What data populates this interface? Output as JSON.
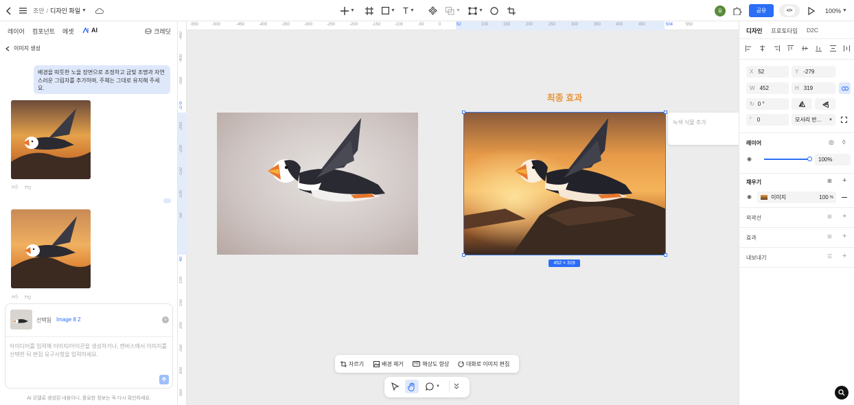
{
  "topbar": {
    "breadcrumb_parent": "조안",
    "breadcrumb_sep": "/",
    "file_name": "디자인 파일",
    "share_label": "공유",
    "code_label": "</>",
    "zoom": "100%",
    "avatar_initial": "유"
  },
  "left": {
    "tabs": [
      "레이어",
      "컴포넌트",
      "에셋",
      "AI"
    ],
    "credit_label": "크레딧",
    "header": "이미지 생성",
    "prompt_text": "배경을 따뜻한 노을 장면으로 조정하고 금빛 조명과 자연스러운 그림자를 추가하며, 주체는 그대로 유지해 주세요.",
    "selected_label": "선택됨",
    "selected_name": "Image 8 2",
    "input_placeholder": "아이디어를 입력해 이미지/아이콘을 생성하거나, 캔버스에서 이미지를 선택한 뒤 편집 요구사항을 입력하세요.",
    "footer_note": "AI 모델로 생성된 내용이니, 중요한 정보는 꼭 다시 확인하세요."
  },
  "ruler_top": [
    "-550",
    "-500",
    "-450",
    "-400",
    "-350",
    "-300",
    "-250",
    "-200",
    "-150",
    "-100",
    "-50",
    "0",
    "52",
    "100",
    "150",
    "200",
    "250",
    "300",
    "350",
    "400",
    "450",
    "504",
    "550"
  ],
  "ruler_left": [
    "-450",
    "-400",
    "-350",
    "-279",
    "-250",
    "-200",
    "-150",
    "-100",
    "-50",
    "40",
    "100",
    "150",
    "200",
    "250",
    "300",
    "350"
  ],
  "canvas": {
    "final_label": "최종 효과",
    "size_badge": "452 × 319",
    "comment_placeholder": "녹색 식물 추가"
  },
  "image_toolbar": {
    "crop": "자르기",
    "remove_bg": "배경 제거",
    "upscale": "해상도 향상",
    "chat_edit": "대화로 이미지 편집"
  },
  "right": {
    "tabs": [
      "디자인",
      "프로토타입",
      "D2C"
    ],
    "x": "52",
    "y": "-279",
    "w": "452",
    "h": "319",
    "rotation": "0 °",
    "radius": "0",
    "corner_mode": "모서리 반...",
    "layer_title": "레이어",
    "opacity": "100%",
    "fill_title": "채우기",
    "fill_type": "이미지",
    "fill_opacity": "100",
    "fill_opacity_unit": "%",
    "stroke_title": "외곽선",
    "effect_title": "효과",
    "export_title": "내보내기"
  },
  "colors": {
    "accent": "#2b6ef6",
    "orange_label": "#e8963a",
    "selection": "#3a78e6"
  }
}
